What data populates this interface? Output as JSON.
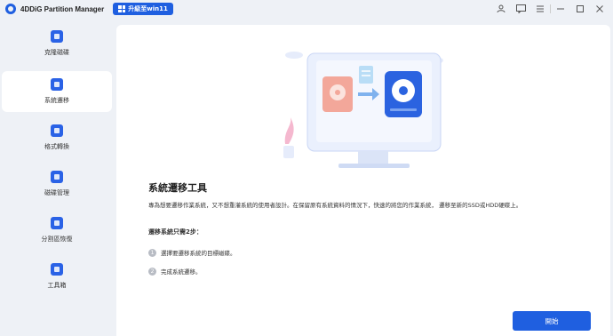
{
  "app": {
    "title": "4DDiG Partition Manager",
    "upgrade_label": "升級至win11"
  },
  "window_controls": [
    "user-icon",
    "feedback-icon",
    "menu-icon",
    "minimize-icon",
    "maximize-icon",
    "close-icon"
  ],
  "sidebar": {
    "items": [
      {
        "label": "克隆磁碟",
        "icon": "clone-disk-icon",
        "active": false
      },
      {
        "label": "系統遷移",
        "icon": "system-migration-icon",
        "active": true
      },
      {
        "label": "格式轉換",
        "icon": "format-convert-icon",
        "active": false
      },
      {
        "label": "磁碟管理",
        "icon": "disk-management-icon",
        "active": false
      },
      {
        "label": "分割區恢復",
        "icon": "partition-recovery-icon",
        "active": false
      },
      {
        "label": "工具箱",
        "icon": "toolbox-icon",
        "active": false
      }
    ]
  },
  "main": {
    "title": "系統遷移工具",
    "description": "專為想要遷移作業系統，又不想重灌系統的使用者設計。在保留原有系統資料的情況下，快速的將您的作業系統， 遷移至新的SSD或HDD硬碟上。",
    "steps_title": "遷移系統只需2步：",
    "steps": [
      {
        "num": "1",
        "text": "選擇要遷移系統的目標磁碟。"
      },
      {
        "num": "2",
        "text": "完成系統遷移。"
      }
    ],
    "start_label": "開始"
  },
  "colors": {
    "accent": "#1f5fe0",
    "background": "#eef1f6",
    "panel": "#ffffff"
  }
}
